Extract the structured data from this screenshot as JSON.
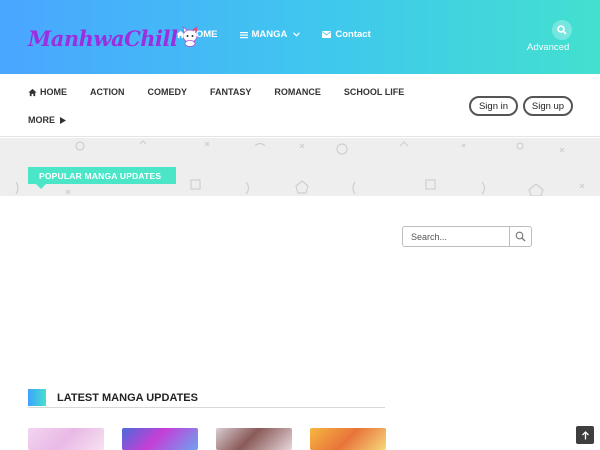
{
  "header": {
    "logo_text": "ManhwaChill",
    "nav": [
      {
        "label": "HOME",
        "icon": "home-icon"
      },
      {
        "label": "MANGA",
        "icon": "menu-icon"
      },
      {
        "label": "Contact",
        "icon": "mail-icon"
      }
    ],
    "advanced_label": "Advanced"
  },
  "catnav": {
    "items": [
      "HOME",
      "ACTION",
      "COMEDY",
      "FANTASY",
      "ROMANCE",
      "SCHOOL LIFE"
    ],
    "more_label": "MORE",
    "signin_label": "Sign in",
    "signup_label": "Sign up"
  },
  "popular": {
    "label": "POPULAR MANGA UPDATES"
  },
  "side_search": {
    "placeholder": "Search..."
  },
  "latest": {
    "title": "LATEST MANGA UPDATES"
  },
  "colors": {
    "header_start": "#4aa6ff",
    "header_end": "#43e0cf",
    "accent_teal": "#4be6c8",
    "logo_purple": "#9a2fe0"
  }
}
